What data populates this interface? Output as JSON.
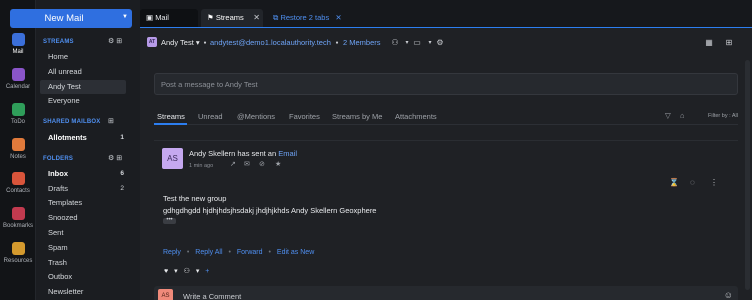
{
  "new_mail": "New Mail",
  "rail": [
    {
      "label": "Mail",
      "icon": "mail-icon",
      "color": "#3b6fd9",
      "active": true
    },
    {
      "label": "Calendar",
      "icon": "calendar-icon",
      "color": "#8a55c9"
    },
    {
      "label": "ToDo",
      "icon": "todo-icon",
      "color": "#2f9e5a"
    },
    {
      "label": "Notes",
      "icon": "notes-icon",
      "color": "#e07a3b"
    },
    {
      "label": "Contacts",
      "icon": "contacts-icon",
      "color": "#d9553b"
    },
    {
      "label": "Bookmarks",
      "icon": "bookmarks-icon",
      "color": "#c23a4f"
    },
    {
      "label": "Resources",
      "icon": "resources-icon",
      "color": "#d49a2e"
    }
  ],
  "sections": {
    "streams": "STREAMS",
    "shared": "SHARED MAILBOX",
    "folders": "FOLDERS"
  },
  "streams": [
    "Home",
    "All unread",
    "Andy Test",
    "Everyone"
  ],
  "shared": [
    {
      "name": "Allotments",
      "count": "1"
    }
  ],
  "folders": [
    {
      "name": "Inbox",
      "count": "6"
    },
    {
      "name": "Drafts",
      "count": "2"
    },
    {
      "name": "Templates",
      "count": ""
    },
    {
      "name": "Snoozed",
      "count": ""
    },
    {
      "name": "Sent",
      "count": ""
    },
    {
      "name": "Spam",
      "count": ""
    },
    {
      "name": "Trash",
      "count": ""
    },
    {
      "name": "Outbox",
      "count": ""
    },
    {
      "name": "Newsletter",
      "count": ""
    }
  ],
  "tabs": {
    "mail": "Mail",
    "streams": "Streams",
    "restore": "Restore 2 tabs"
  },
  "header": {
    "avatar": "AT",
    "name": "Andy Test",
    "email": "andytest@demo1.localauthority.tech",
    "members": "2 Members"
  },
  "post": {
    "placeholder": "Post a message to Andy Test"
  },
  "stream_tabs": [
    "Streams",
    "Unread",
    "@Mentions",
    "Favorites",
    "Streams by Me",
    "Attachments"
  ],
  "filter": "Filter by : All",
  "card": {
    "avatar": "AS",
    "sender": "Andy Skellern has sent an",
    "sender_link": "Email",
    "time": "1 min ago",
    "subject": "Test the new group",
    "body": "gdhgdhgdd hjdhjhdsjhsdakj jhdjhjkhds Andy Skellern Geoxphere",
    "more": "•••",
    "actions": [
      "Reply",
      "Reply All",
      "Forward",
      "Edit as New"
    ]
  },
  "comment": {
    "avatar": "AS",
    "placeholder": "Write a Comment"
  }
}
